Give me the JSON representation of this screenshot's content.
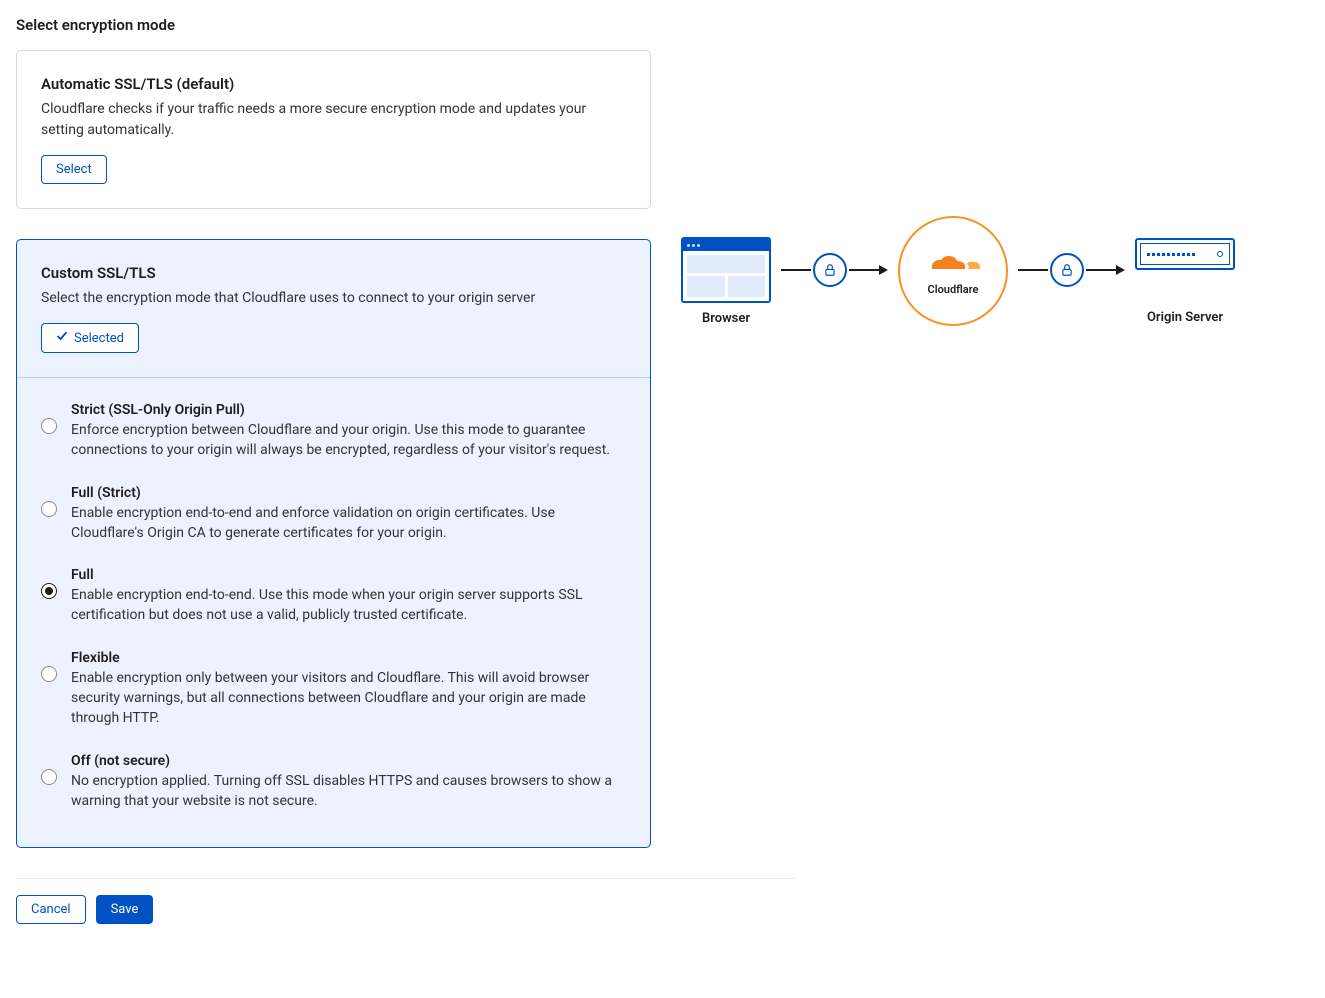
{
  "heading": "Select encryption mode",
  "automatic": {
    "title": "Automatic SSL/TLS (default)",
    "desc": "Cloudflare checks if your traffic needs a more secure encryption mode and updates your setting automatically.",
    "button": "Select"
  },
  "custom": {
    "title": "Custom SSL/TLS",
    "desc": "Select the encryption mode that Cloudflare uses to connect to your origin server",
    "button": "Selected"
  },
  "modes": [
    {
      "key": "strict",
      "title": "Strict (SSL-Only Origin Pull)",
      "desc": "Enforce encryption between Cloudflare and your origin. Use this mode to guarantee connections to your origin will always be encrypted, regardless of your visitor's request.",
      "checked": false
    },
    {
      "key": "full-strict",
      "title": "Full (Strict)",
      "desc": "Enable encryption end-to-end and enforce validation on origin certificates. Use Cloudflare's Origin CA to generate certificates for your origin.",
      "checked": false
    },
    {
      "key": "full",
      "title": "Full",
      "desc": "Enable encryption end-to-end. Use this mode when your origin server supports SSL certification but does not use a valid, publicly trusted certificate.",
      "checked": true
    },
    {
      "key": "flexible",
      "title": "Flexible",
      "desc": "Enable encryption only between your visitors and Cloudflare. This will avoid browser security warnings, but all connections between Cloudflare and your origin are made through HTTP.",
      "checked": false
    },
    {
      "key": "off",
      "title": "Off (not secure)",
      "desc": "No encryption applied. Turning off SSL disables HTTPS and causes browsers to show a warning that your website is not secure.",
      "checked": false
    }
  ],
  "footer": {
    "cancel": "Cancel",
    "save": "Save"
  },
  "diagram": {
    "browser": "Browser",
    "cloudflare": "Cloudflare",
    "origin": "Origin Server"
  },
  "colors": {
    "accent": "#0051c3",
    "orange": "#f6821f"
  }
}
